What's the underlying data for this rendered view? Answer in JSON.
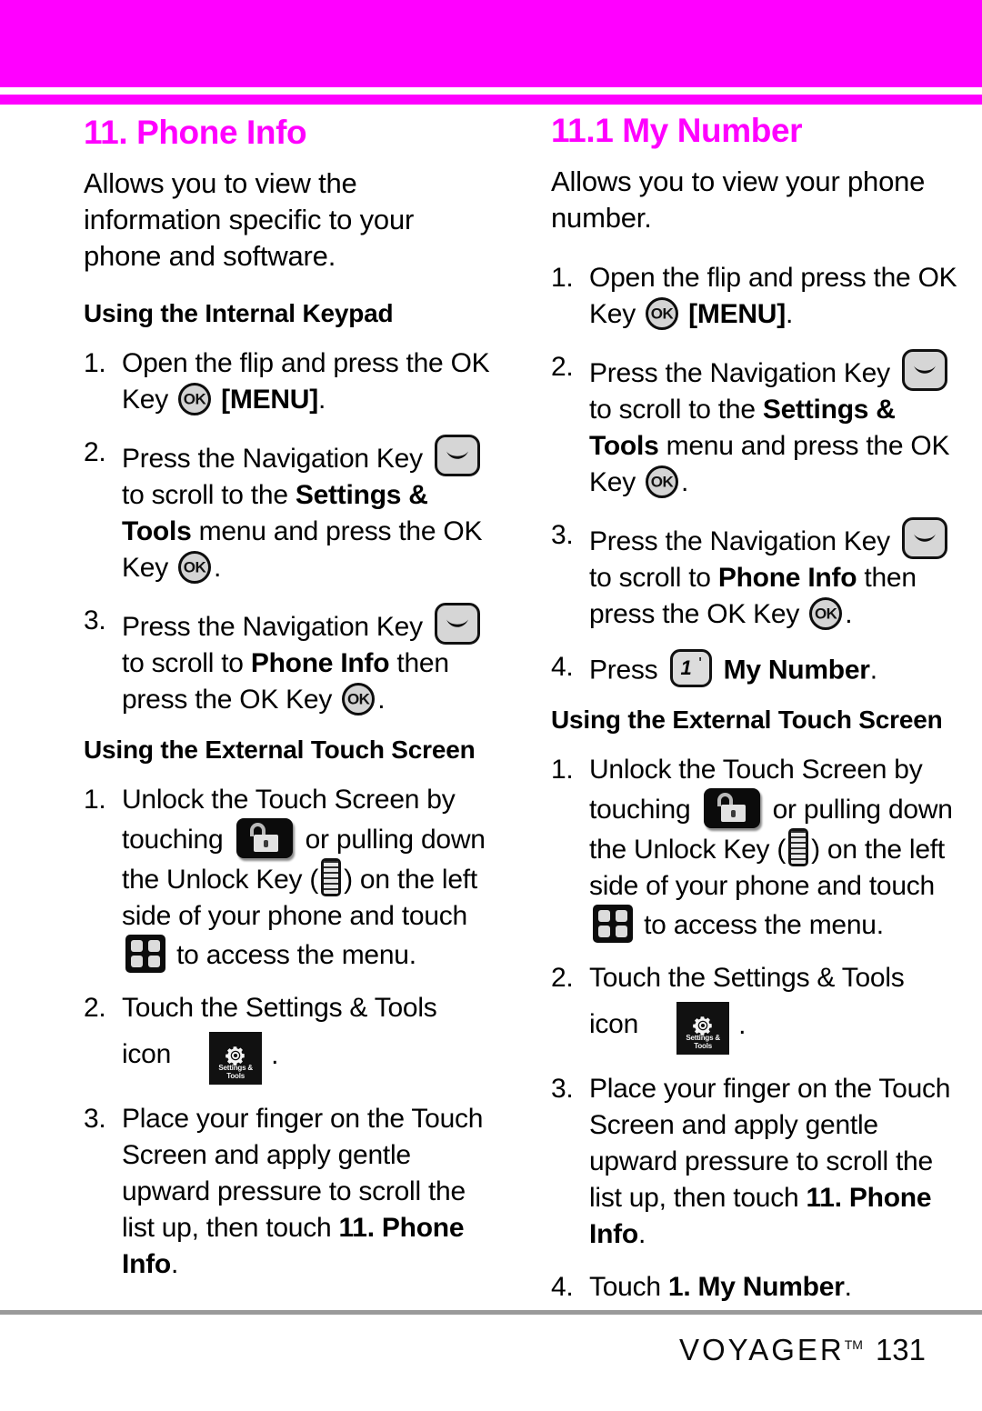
{
  "page": {
    "background_color": "#ffffff",
    "accent_color": "#ff00ff",
    "footer_rule_color": "#9a9a9a"
  },
  "left_column": {
    "title": "11. Phone Info",
    "intro": "Allows you to view the information specific to your phone and software.",
    "keypad_subhead": "Using the Internal Keypad",
    "keypad_steps": {
      "s1_num": "1.",
      "s1_a": "Open the flip and press the OK Key",
      "s1_b": "[MENU]",
      "s1_c": ".",
      "s2_num": "2.",
      "s2_a": "Press the Navigation Key",
      "s2_b": "to scroll to the",
      "s2_bold": "Settings & Tools",
      "s2_c": "menu and press the OK Key",
      "s2_d": ".",
      "s3_num": "3.",
      "s3_a": "Press the Navigation Key",
      "s3_b": "to scroll to",
      "s3_bold": "Phone Info",
      "s3_c": "then press the OK Key",
      "s3_d": "."
    },
    "touch_subhead": "Using the External Touch Screen",
    "touch_steps": {
      "t1_num": "1.",
      "t1_a": "Unlock the Touch Screen by touching",
      "t1_b": "or pulling down the Unlock Key (",
      "t1_c": ") on the left side of your phone and touch",
      "t1_d": "to access the menu.",
      "t2_num": "2.",
      "t2_a": "Touch the Settings & Tools icon",
      "t2_dot": ".",
      "t3_num": "3.",
      "t3_a": "Place your finger on the Touch Screen and apply gentle upward pressure to scroll the list up, then touch",
      "t3_bold": "11. Phone Info",
      "t3_b": "."
    }
  },
  "right_column": {
    "title": "11.1 My Number",
    "intro": "Allows you to view your phone number.",
    "keypad_steps": {
      "s1_num": "1.",
      "s1_a": "Open the flip and press the OK Key",
      "s1_b": "[MENU]",
      "s1_c": ".",
      "s2_num": "2.",
      "s2_a": "Press the Navigation Key",
      "s2_b": "to scroll to the",
      "s2_bold": "Settings & Tools",
      "s2_c": "menu and press the OK Key",
      "s2_d": ".",
      "s3_num": "3.",
      "s3_a": "Press the Navigation Key",
      "s3_b": "to scroll to",
      "s3_bold": "Phone Info",
      "s3_c": "then press the OK Key",
      "s3_d": ".",
      "s4_num": "4.",
      "s4_a": "Press",
      "s4_bold": "My Number",
      "s4_b": "."
    },
    "touch_subhead": "Using the External Touch Screen",
    "touch_steps": {
      "t1_num": "1.",
      "t1_a": "Unlock the Touch Screen by touching",
      "t1_b": "or pulling down the Unlock Key (",
      "t1_c": ") on the left side of your phone and touch",
      "t1_d": "to access the menu.",
      "t2_num": "2.",
      "t2_a": "Touch the Settings & Tools icon",
      "t2_dot": ".",
      "t3_num": "3.",
      "t3_a": "Place your finger on the Touch Screen and apply gentle upward pressure to scroll the list up, then touch",
      "t3_bold": "11. Phone Info",
      "t3_b": ".",
      "t4_num": "4.",
      "t4_a": "Touch",
      "t4_bold": "1. My Number",
      "t4_b": "."
    }
  },
  "icons": {
    "ok_key_label": "OK",
    "key_one_digit": "1",
    "key_one_mark": "'",
    "settings_tile_line1": "Settings &",
    "settings_tile_line2": "Tools"
  },
  "footer": {
    "brand": "VOYAGER",
    "tm": "TM",
    "page_number": "131"
  }
}
